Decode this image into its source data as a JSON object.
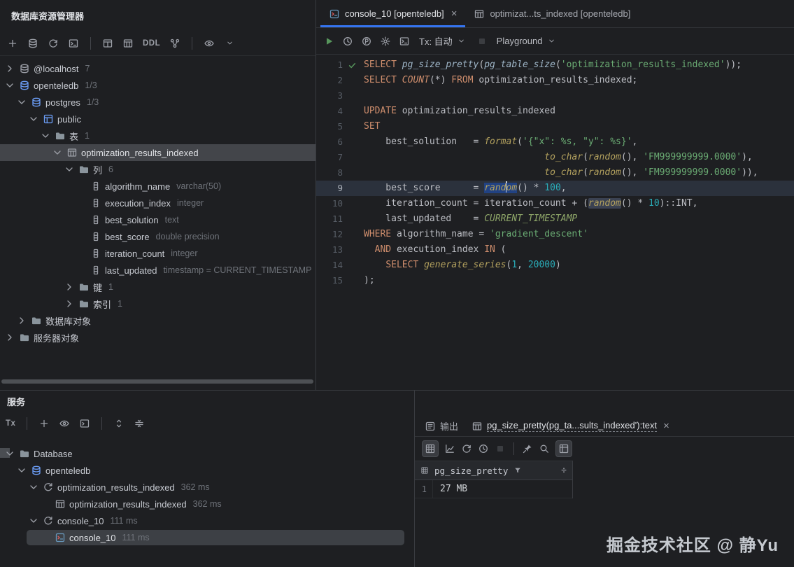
{
  "watermark": "掘金技术社区 @ 静Yu",
  "explorer": {
    "title": "数据库资源管理器",
    "toolbar": [
      "add",
      "datasource",
      "refresh",
      "query-console",
      "divider",
      "layout",
      "table",
      "ddl",
      "diagram",
      "divider",
      "eye",
      "chevron-small"
    ],
    "tree": [
      {
        "depth": 0,
        "chevron": "right",
        "icon": "datasource",
        "label": "@localhost",
        "badge": "7"
      },
      {
        "depth": 0,
        "chevron": "down",
        "icon": "postgres",
        "label": "openteledb",
        "badge": "1/3"
      },
      {
        "depth": 1,
        "chevron": "down",
        "icon": "database",
        "label": "postgres",
        "badge": "1/3"
      },
      {
        "depth": 2,
        "chevron": "down",
        "icon": "schema",
        "label": "public"
      },
      {
        "depth": 3,
        "chevron": "down",
        "icon": "folder",
        "label": "表",
        "badge": "1"
      },
      {
        "depth": 4,
        "chevron": "down",
        "icon": "table",
        "label": "optimization_results_indexed",
        "selected": true
      },
      {
        "depth": 5,
        "chevron": "down",
        "icon": "folder",
        "label": "列",
        "badge": "6"
      },
      {
        "depth": 6,
        "icon": "column",
        "label": "algorithm_name",
        "type": "varchar(50)"
      },
      {
        "depth": 6,
        "icon": "column",
        "label": "execution_index",
        "type": "integer"
      },
      {
        "depth": 6,
        "icon": "column",
        "label": "best_solution",
        "type": "text"
      },
      {
        "depth": 6,
        "icon": "column",
        "label": "best_score",
        "type": "double precision"
      },
      {
        "depth": 6,
        "icon": "column",
        "label": "iteration_count",
        "type": "integer"
      },
      {
        "depth": 6,
        "icon": "column",
        "label": "last_updated",
        "type": "timestamp = CURRENT_TIMESTAMP"
      },
      {
        "depth": 5,
        "chevron": "right",
        "icon": "folder",
        "label": "键",
        "badge": "1"
      },
      {
        "depth": 5,
        "chevron": "right",
        "icon": "folder",
        "label": "索引",
        "badge": "1"
      },
      {
        "depth": 1,
        "chevron": "right",
        "icon": "folder",
        "label": "数据库对象"
      },
      {
        "depth": 0,
        "chevron": "right",
        "icon": "folder",
        "label": "服务器对象"
      }
    ]
  },
  "editor": {
    "tabs": [
      {
        "label": "console_10 [openteledb]",
        "icon": "console-file",
        "active": true,
        "closable": true
      },
      {
        "label": "optimizat...ts_indexed [openteledb]",
        "icon": "table",
        "active": false,
        "closable": false
      }
    ],
    "toolbar": {
      "icons": [
        "run",
        "history",
        "profile",
        "settings",
        "terminal"
      ],
      "tx": "Tx: 自动",
      "playground": "Playground"
    },
    "lines": [
      {
        "no": "1",
        "check": true,
        "tokens": [
          [
            "kw",
            "SELECT "
          ],
          [
            "fn",
            "pg_size_pretty"
          ],
          [
            "pl",
            "("
          ],
          [
            "fn",
            "pg_table_size"
          ],
          [
            "pl",
            "("
          ],
          [
            "str",
            "'optimization_results_indexed'"
          ],
          [
            "pl",
            "));"
          ]
        ]
      },
      {
        "no": "2",
        "tokens": [
          [
            "kw",
            "SELECT "
          ],
          [
            "kwit",
            "COUNT"
          ],
          [
            "pl",
            "(*) "
          ],
          [
            "kw",
            "FROM "
          ],
          [
            "pl",
            "optimization_results_indexed;"
          ]
        ]
      },
      {
        "no": "3",
        "tokens": []
      },
      {
        "no": "4",
        "tokens": [
          [
            "kw",
            "UPDATE "
          ],
          [
            "pl",
            "optimization_results_indexed"
          ]
        ]
      },
      {
        "no": "5",
        "tokens": [
          [
            "kw",
            "SET"
          ]
        ]
      },
      {
        "no": "6",
        "tokens": [
          [
            "pl",
            "    best_solution   = "
          ],
          [
            "fn2",
            "format"
          ],
          [
            "pl",
            "("
          ],
          [
            "str",
            "'{\"x\": %s, \"y\": %s}'"
          ],
          [
            "pl",
            ","
          ]
        ]
      },
      {
        "no": "7",
        "tokens": [
          [
            "pl",
            "                                 "
          ],
          [
            "fn2",
            "to_char"
          ],
          [
            "pl",
            "("
          ],
          [
            "fn2",
            "random"
          ],
          [
            "pl",
            "(), "
          ],
          [
            "str",
            "'FM999999999.0000'"
          ],
          [
            "pl",
            "),"
          ]
        ]
      },
      {
        "no": "8",
        "tokens": [
          [
            "pl",
            "                                 "
          ],
          [
            "fn2",
            "to_char"
          ],
          [
            "pl",
            "("
          ],
          [
            "fn2",
            "random"
          ],
          [
            "pl",
            "(), "
          ],
          [
            "str",
            "'FM999999999.0000'"
          ],
          [
            "pl",
            ")),"
          ]
        ]
      },
      {
        "no": "9",
        "current": true,
        "tokens": [
          [
            "pl",
            "    best_score      = "
          ],
          [
            "fn2 sel",
            "rand"
          ],
          [
            "caret",
            ""
          ],
          [
            "fn2 sel",
            "om"
          ],
          [
            "pl",
            "() * "
          ],
          [
            "num",
            "100"
          ],
          [
            "pl",
            ","
          ]
        ]
      },
      {
        "no": "10",
        "tokens": [
          [
            "pl",
            "    iteration_count = iteration_count + ("
          ],
          [
            "fn2 occ",
            "random"
          ],
          [
            "pl",
            "() * "
          ],
          [
            "num",
            "10"
          ],
          [
            "pl",
            ")::INT,"
          ]
        ]
      },
      {
        "no": "11",
        "tokens": [
          [
            "pl",
            "    last_updated    = "
          ],
          [
            "ct",
            "CURRENT_TIMESTAMP"
          ]
        ]
      },
      {
        "no": "12",
        "tokens": [
          [
            "kw",
            "WHERE "
          ],
          [
            "pl",
            "algorithm_name = "
          ],
          [
            "str",
            "'gradient_descent'"
          ]
        ]
      },
      {
        "no": "13",
        "tokens": [
          [
            "pl",
            "  "
          ],
          [
            "kw",
            "AND "
          ],
          [
            "pl",
            "execution_index "
          ],
          [
            "kw",
            "IN"
          ],
          [
            "pl",
            " ("
          ]
        ]
      },
      {
        "no": "14",
        "tokens": [
          [
            "pl",
            "    "
          ],
          [
            "kw",
            "SELECT "
          ],
          [
            "fn2",
            "generate_series"
          ],
          [
            "pl",
            "("
          ],
          [
            "num",
            "1"
          ],
          [
            "pl",
            ", "
          ],
          [
            "num",
            "20000"
          ],
          [
            "pl",
            ")"
          ]
        ]
      },
      {
        "no": "15",
        "tokens": [
          [
            "pl",
            ");"
          ]
        ]
      }
    ]
  },
  "services": {
    "title": "服务",
    "toolbar": [
      "tx",
      "divider",
      "add",
      "eye",
      "open-console",
      "divider",
      "updown",
      "collapse-all"
    ],
    "tree": [
      {
        "depth": 0,
        "chevron": "down",
        "icon": "folder",
        "label": "Database"
      },
      {
        "depth": 1,
        "chevron": "down",
        "icon": "postgres",
        "label": "openteledb"
      },
      {
        "depth": 2,
        "chevron": "down",
        "icon": "session",
        "label": "optimization_results_indexed",
        "time": "362 ms"
      },
      {
        "depth": 3,
        "icon": "table",
        "label": "optimization_results_indexed",
        "time": "362 ms"
      },
      {
        "depth": 2,
        "chevron": "down",
        "icon": "session",
        "label": "console_10",
        "time": "111 ms"
      },
      {
        "depth": 3,
        "icon": "console-file",
        "label": "console_10",
        "time": "111 ms",
        "selected": true
      }
    ]
  },
  "results": {
    "tabs": [
      {
        "label": "输出",
        "icon": "output",
        "active": false,
        "closable": false
      },
      {
        "label": "pg_size_pretty(pg_ta...sults_indexed'):text",
        "icon": "table",
        "active": true,
        "closable": true
      }
    ],
    "toolbar": [
      "grid:boxed",
      "chart",
      "refresh",
      "clock",
      "stop:disabled",
      "divider",
      "pin",
      "search",
      "transpose:boxed"
    ],
    "grid": {
      "column": "pg_size_pretty",
      "rows": [
        [
          "1",
          "27 MB"
        ]
      ]
    }
  }
}
